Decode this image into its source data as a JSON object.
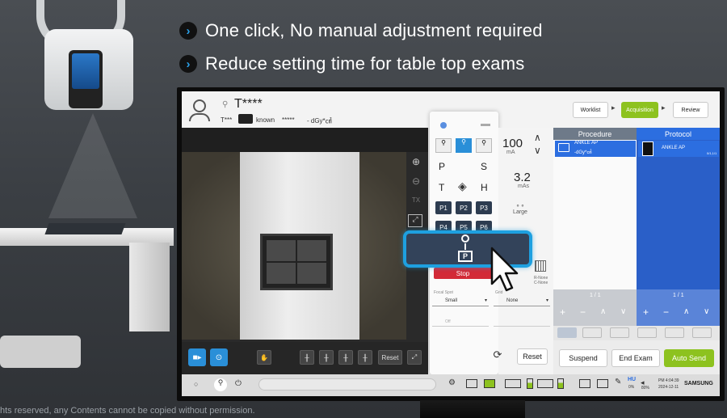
{
  "headlines": [
    "One click, No manual adjustment required",
    "Reduce setting time for  table top exams"
  ],
  "copyright": "hts reserved, any Contents cannot be copied  without permission.",
  "patient": {
    "name": "T****",
    "id_row": "T***",
    "unknown": "known",
    "dose_mask": "*****",
    "dose_unit": "- dGy*㎠"
  },
  "workflow": {
    "worklist": "Worklist",
    "acquisition": "Acquisition",
    "review": "Review"
  },
  "viewer_tools": {
    "reset": "Reset",
    "tx": "TX"
  },
  "position_panel": {
    "p": "P",
    "s": "S",
    "t": "T",
    "h": "H",
    "presets": [
      "P1",
      "P2",
      "P3",
      "P4",
      "P5",
      "P6"
    ],
    "stop": "Stop",
    "large": "Large",
    "focal": "Focal Spot",
    "focal_value": "Small",
    "grid": "Grid",
    "grid_value": "None",
    "off": "Off",
    "reset": "Reset",
    "rnone": "R-None",
    "cnone": "C-None"
  },
  "exposure": {
    "ma": "100",
    "ma_unit": "mA",
    "mas": "3.2",
    "mas_unit": "mAs"
  },
  "procedure_panel": {
    "procedure_header": "Procedure",
    "protocol_header": "Protocol",
    "procedure_name": "ANKLE AP",
    "procedure_dose": "-dGy*㎠",
    "protocol_name": "ANKLE AP",
    "protocol_meta": "0/1,1/1",
    "page_left": "1 / 1",
    "page_right": "1 / 1"
  },
  "actions": {
    "suspend": "Suspend",
    "end_exam": "End Exam",
    "auto_send": "Auto Send"
  },
  "status_bar": {
    "hu_label": "HU",
    "hu_value": "0%",
    "vol_value": "80%",
    "time": "PM 4:04:39",
    "date": "2024-12-11",
    "brand": "SAMSUNG"
  },
  "colors": {
    "accent_green": "#8dc21f",
    "protocol_blue": "#2c6ee0",
    "header_dark": "#6e7a89",
    "popup_border": "#1ea0e0",
    "stop_red": "#d32a37",
    "highlight_blue": "#2aa0e8"
  }
}
